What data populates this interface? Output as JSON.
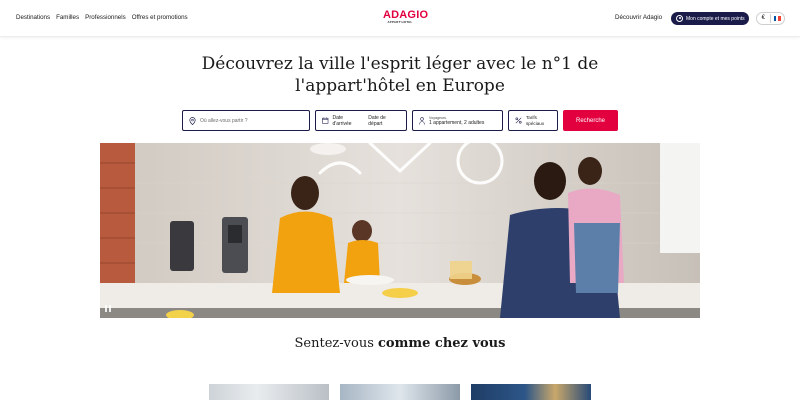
{
  "header": {
    "nav": [
      "Destinations",
      "Familles",
      "Professionnels",
      "Offres et promotions"
    ],
    "logo": {
      "main": "ADAGIO",
      "sub": "APPART'HOTEL"
    },
    "discover": "Découvrir Adagio",
    "account_button": "Mon compte et mes points",
    "currency": "€",
    "language_flag": "fr-flag-icon"
  },
  "hero": {
    "title_line1": "Découvrez la ville l'esprit léger avec le n°1 de",
    "title_line2": "l'appart'hôtel en Europe"
  },
  "search": {
    "destination_placeholder": "Où allez-vous partir ?",
    "arrival_label": "Date d'arrivée",
    "departure_label": "Date de départ",
    "guests_label": "Voyageurs",
    "guests_value": "1 appartement, 2 adultes",
    "rates_line1": "Tarifs",
    "rates_line2": "spéciaux",
    "search_button": "Recherche"
  },
  "section": {
    "title_regular": "Sentez-vous ",
    "title_bold": "comme chez vous"
  },
  "colors": {
    "brand_red": "#e2003f",
    "navy": "#1b1b4a"
  }
}
